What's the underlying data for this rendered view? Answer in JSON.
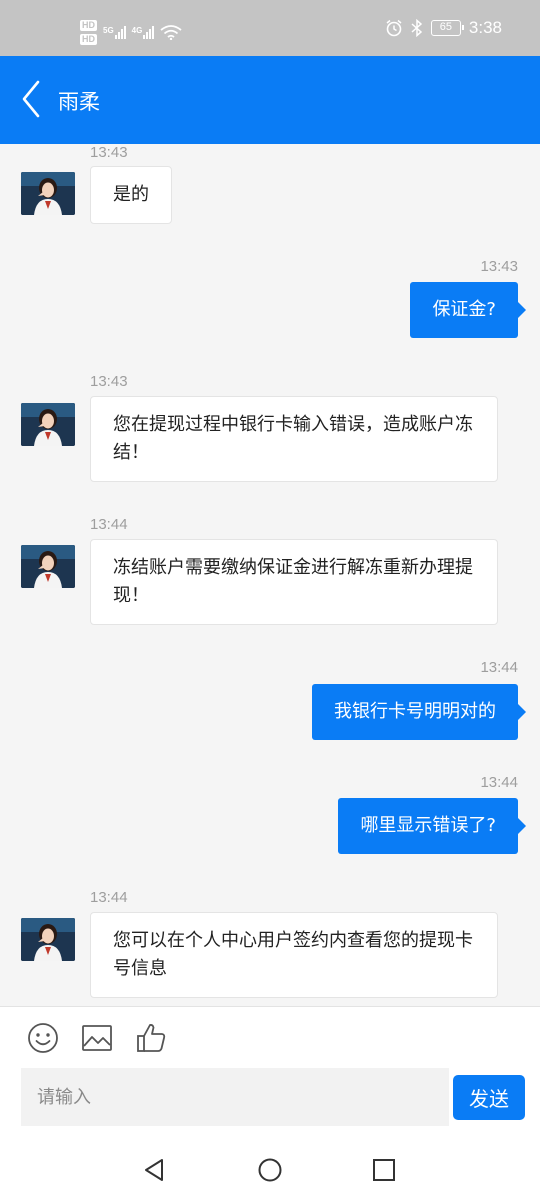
{
  "status_bar": {
    "hd_badges": [
      "HD",
      "HD"
    ],
    "network_1": "5G",
    "network_2": "4G",
    "battery_level": "65",
    "time": "3:38",
    "icons": [
      "alarm-icon",
      "bluetooth-icon",
      "battery-icon",
      "wifi-icon"
    ]
  },
  "header": {
    "title": "雨柔",
    "back_icon": "chevron-left-icon",
    "background_color": "#0a7cf5"
  },
  "messages": [
    {
      "side": "left",
      "time": "13:43",
      "text": "是的"
    },
    {
      "side": "right",
      "time": "13:43",
      "text": "保证金?"
    },
    {
      "side": "left",
      "time": "13:43",
      "text": "您在提现过程中银行卡输入错误，造成账户冻结！"
    },
    {
      "side": "left",
      "time": "13:44",
      "text": "冻结账户需要缴纳保证金进行解冻重新办理提现！"
    },
    {
      "side": "right",
      "time": "13:44",
      "text": "我银行卡号明明对的"
    },
    {
      "side": "right",
      "time": "13:44",
      "text": "哪里显示错误了?"
    },
    {
      "side": "left",
      "time": "13:44",
      "text": "您可以在个人中心用户签约内查看您的提现卡号信息"
    }
  ],
  "input": {
    "placeholder": "请输入",
    "value": "",
    "send_label": "发送",
    "tool_icons": [
      "emoji-icon",
      "image-icon",
      "thumbs-up-icon"
    ]
  },
  "nav_bar": {
    "icons": [
      "back-triangle-icon",
      "home-circle-icon",
      "recents-square-icon"
    ]
  },
  "colors": {
    "accent": "#0a7cf5",
    "status_bar": "#c4c4c4",
    "chat_background": "#f5f5f5",
    "timestamp": "#9e9e9e"
  }
}
